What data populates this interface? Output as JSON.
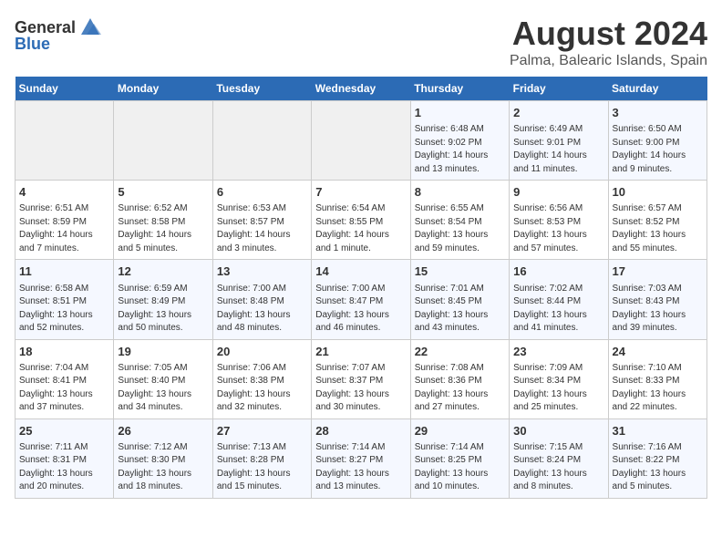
{
  "logo": {
    "text_general": "General",
    "text_blue": "Blue"
  },
  "title": "August 2024",
  "subtitle": "Palma, Balearic Islands, Spain",
  "weekdays": [
    "Sunday",
    "Monday",
    "Tuesday",
    "Wednesday",
    "Thursday",
    "Friday",
    "Saturday"
  ],
  "weeks": [
    [
      {
        "day": "",
        "info": ""
      },
      {
        "day": "",
        "info": ""
      },
      {
        "day": "",
        "info": ""
      },
      {
        "day": "",
        "info": ""
      },
      {
        "day": "1",
        "info": "Sunrise: 6:48 AM\nSunset: 9:02 PM\nDaylight: 14 hours\nand 13 minutes."
      },
      {
        "day": "2",
        "info": "Sunrise: 6:49 AM\nSunset: 9:01 PM\nDaylight: 14 hours\nand 11 minutes."
      },
      {
        "day": "3",
        "info": "Sunrise: 6:50 AM\nSunset: 9:00 PM\nDaylight: 14 hours\nand 9 minutes."
      }
    ],
    [
      {
        "day": "4",
        "info": "Sunrise: 6:51 AM\nSunset: 8:59 PM\nDaylight: 14 hours\nand 7 minutes."
      },
      {
        "day": "5",
        "info": "Sunrise: 6:52 AM\nSunset: 8:58 PM\nDaylight: 14 hours\nand 5 minutes."
      },
      {
        "day": "6",
        "info": "Sunrise: 6:53 AM\nSunset: 8:57 PM\nDaylight: 14 hours\nand 3 minutes."
      },
      {
        "day": "7",
        "info": "Sunrise: 6:54 AM\nSunset: 8:55 PM\nDaylight: 14 hours\nand 1 minute."
      },
      {
        "day": "8",
        "info": "Sunrise: 6:55 AM\nSunset: 8:54 PM\nDaylight: 13 hours\nand 59 minutes."
      },
      {
        "day": "9",
        "info": "Sunrise: 6:56 AM\nSunset: 8:53 PM\nDaylight: 13 hours\nand 57 minutes."
      },
      {
        "day": "10",
        "info": "Sunrise: 6:57 AM\nSunset: 8:52 PM\nDaylight: 13 hours\nand 55 minutes."
      }
    ],
    [
      {
        "day": "11",
        "info": "Sunrise: 6:58 AM\nSunset: 8:51 PM\nDaylight: 13 hours\nand 52 minutes."
      },
      {
        "day": "12",
        "info": "Sunrise: 6:59 AM\nSunset: 8:49 PM\nDaylight: 13 hours\nand 50 minutes."
      },
      {
        "day": "13",
        "info": "Sunrise: 7:00 AM\nSunset: 8:48 PM\nDaylight: 13 hours\nand 48 minutes."
      },
      {
        "day": "14",
        "info": "Sunrise: 7:00 AM\nSunset: 8:47 PM\nDaylight: 13 hours\nand 46 minutes."
      },
      {
        "day": "15",
        "info": "Sunrise: 7:01 AM\nSunset: 8:45 PM\nDaylight: 13 hours\nand 43 minutes."
      },
      {
        "day": "16",
        "info": "Sunrise: 7:02 AM\nSunset: 8:44 PM\nDaylight: 13 hours\nand 41 minutes."
      },
      {
        "day": "17",
        "info": "Sunrise: 7:03 AM\nSunset: 8:43 PM\nDaylight: 13 hours\nand 39 minutes."
      }
    ],
    [
      {
        "day": "18",
        "info": "Sunrise: 7:04 AM\nSunset: 8:41 PM\nDaylight: 13 hours\nand 37 minutes."
      },
      {
        "day": "19",
        "info": "Sunrise: 7:05 AM\nSunset: 8:40 PM\nDaylight: 13 hours\nand 34 minutes."
      },
      {
        "day": "20",
        "info": "Sunrise: 7:06 AM\nSunset: 8:38 PM\nDaylight: 13 hours\nand 32 minutes."
      },
      {
        "day": "21",
        "info": "Sunrise: 7:07 AM\nSunset: 8:37 PM\nDaylight: 13 hours\nand 30 minutes."
      },
      {
        "day": "22",
        "info": "Sunrise: 7:08 AM\nSunset: 8:36 PM\nDaylight: 13 hours\nand 27 minutes."
      },
      {
        "day": "23",
        "info": "Sunrise: 7:09 AM\nSunset: 8:34 PM\nDaylight: 13 hours\nand 25 minutes."
      },
      {
        "day": "24",
        "info": "Sunrise: 7:10 AM\nSunset: 8:33 PM\nDaylight: 13 hours\nand 22 minutes."
      }
    ],
    [
      {
        "day": "25",
        "info": "Sunrise: 7:11 AM\nSunset: 8:31 PM\nDaylight: 13 hours\nand 20 minutes."
      },
      {
        "day": "26",
        "info": "Sunrise: 7:12 AM\nSunset: 8:30 PM\nDaylight: 13 hours\nand 18 minutes."
      },
      {
        "day": "27",
        "info": "Sunrise: 7:13 AM\nSunset: 8:28 PM\nDaylight: 13 hours\nand 15 minutes."
      },
      {
        "day": "28",
        "info": "Sunrise: 7:14 AM\nSunset: 8:27 PM\nDaylight: 13 hours\nand 13 minutes."
      },
      {
        "day": "29",
        "info": "Sunrise: 7:14 AM\nSunset: 8:25 PM\nDaylight: 13 hours\nand 10 minutes."
      },
      {
        "day": "30",
        "info": "Sunrise: 7:15 AM\nSunset: 8:24 PM\nDaylight: 13 hours\nand 8 minutes."
      },
      {
        "day": "31",
        "info": "Sunrise: 7:16 AM\nSunset: 8:22 PM\nDaylight: 13 hours\nand 5 minutes."
      }
    ]
  ]
}
